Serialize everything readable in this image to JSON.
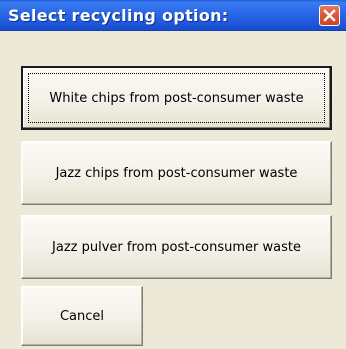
{
  "window": {
    "title": "Select recycling option:",
    "close_icon": "close-icon",
    "titlebar_color": "#2a67e6",
    "close_color": "#dc5a3a",
    "background": "#ece9d8"
  },
  "buttons": {
    "white_chips": "White chips from post-consumer waste",
    "jazz_chips": "Jazz chips from post-consumer waste",
    "jazz_pulver": "Jazz pulver from post-consumer waste",
    "cancel": "Cancel"
  }
}
